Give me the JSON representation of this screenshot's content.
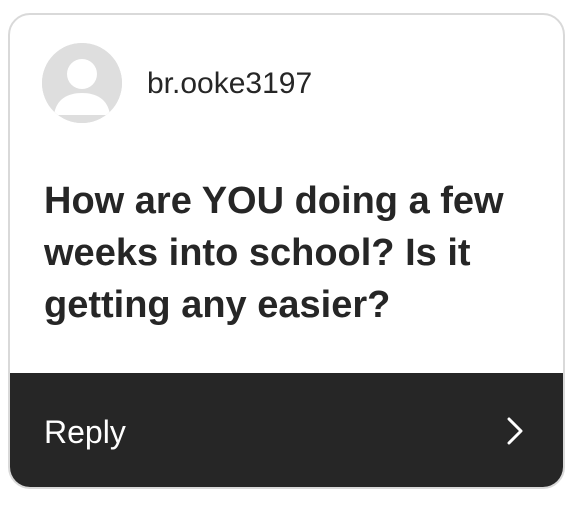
{
  "profile": {
    "username": "br.ooke3197",
    "avatar_icon": "default-user-avatar-icon"
  },
  "message": {
    "text": "How are YOU doing a few weeks into school? Is it getting any easier?"
  },
  "reply": {
    "label": "Reply",
    "icon": "chevron-right-icon"
  },
  "colors": {
    "bar_background": "#262626",
    "text": "#262626",
    "avatar_background": "#dedede",
    "border": "#d9d9d9"
  }
}
